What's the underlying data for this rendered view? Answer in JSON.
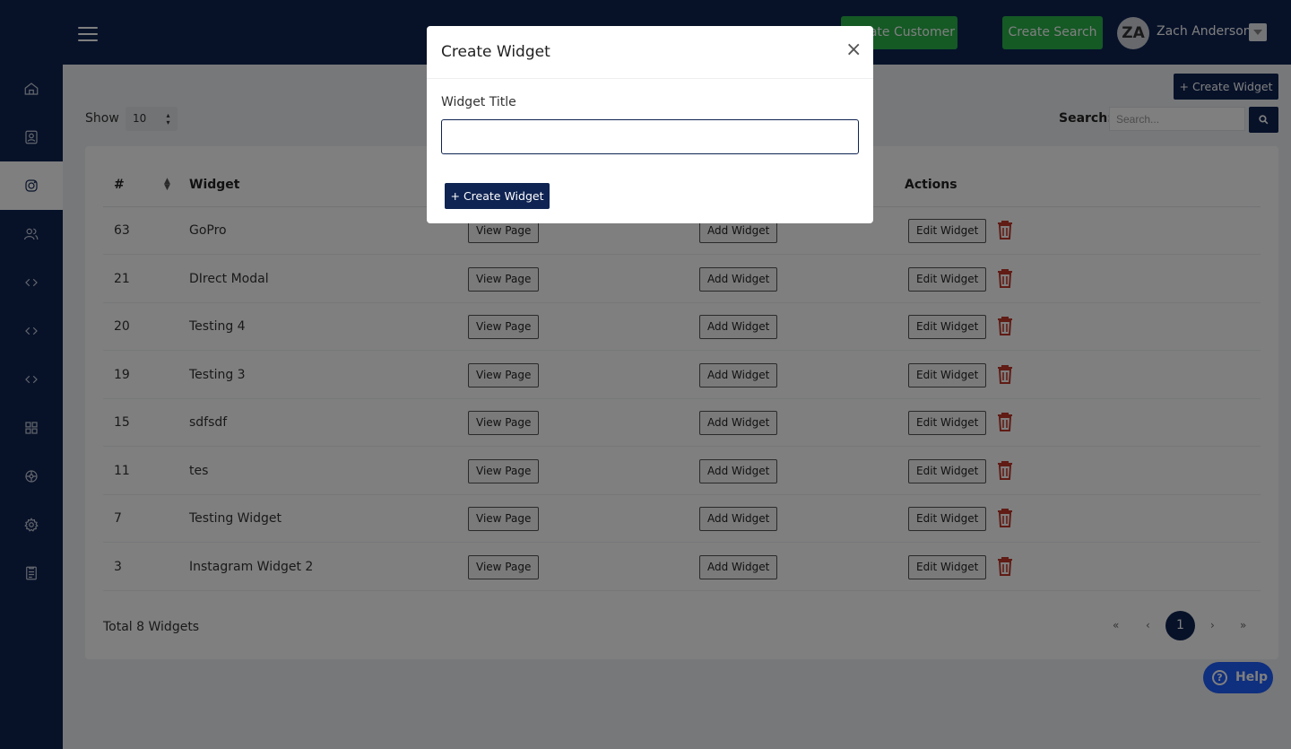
{
  "topbar": {
    "create_customer_label": "Create Customer",
    "create_search_label": "Create Search",
    "user": {
      "initials": "ZA",
      "name": "Zach Anderson"
    }
  },
  "sidebar": {
    "items": [
      {
        "icon": "home-icon"
      },
      {
        "icon": "contact-icon"
      },
      {
        "icon": "instagram-icon",
        "active": true
      },
      {
        "icon": "users-icon"
      },
      {
        "icon": "code-icon"
      },
      {
        "icon": "code-icon"
      },
      {
        "icon": "code-icon"
      },
      {
        "icon": "grid-icon"
      },
      {
        "icon": "palette-icon"
      },
      {
        "icon": "gear-icon"
      },
      {
        "icon": "report-icon"
      }
    ]
  },
  "toolbar": {
    "create_widget_label": "Create Widget",
    "show_label": "Show",
    "page_size": "10",
    "search_label": "Search:",
    "search_placeholder": "Search..."
  },
  "table": {
    "columns": [
      "#",
      "Widget",
      "Actions"
    ],
    "view_label": "View Page",
    "add_label": "Add Widget",
    "edit_label": "Edit Widget",
    "rows": [
      {
        "id": "63",
        "name": "GoPro"
      },
      {
        "id": "21",
        "name": "DIrect Modal"
      },
      {
        "id": "20",
        "name": "Testing 4"
      },
      {
        "id": "19",
        "name": "Testing 3"
      },
      {
        "id": "15",
        "name": "sdfsdf"
      },
      {
        "id": "11",
        "name": "tes"
      },
      {
        "id": "7",
        "name": "Testing Widget"
      },
      {
        "id": "3",
        "name": "Instagram Widget 2"
      }
    ],
    "total": "Total 8 Widgets"
  },
  "pagination": {
    "first": "«",
    "prev": "‹",
    "current": "1",
    "next": "›",
    "last": "»"
  },
  "help_label": "Help",
  "modal": {
    "title": "Create Widget",
    "close": "×",
    "field_label": "Widget Title",
    "field_value": "",
    "submit_label": "Create Widget"
  },
  "colors": {
    "navy": "#0f2452",
    "green": "#2bb34a",
    "danger": "#c0392b",
    "help": "#1e5eff"
  }
}
